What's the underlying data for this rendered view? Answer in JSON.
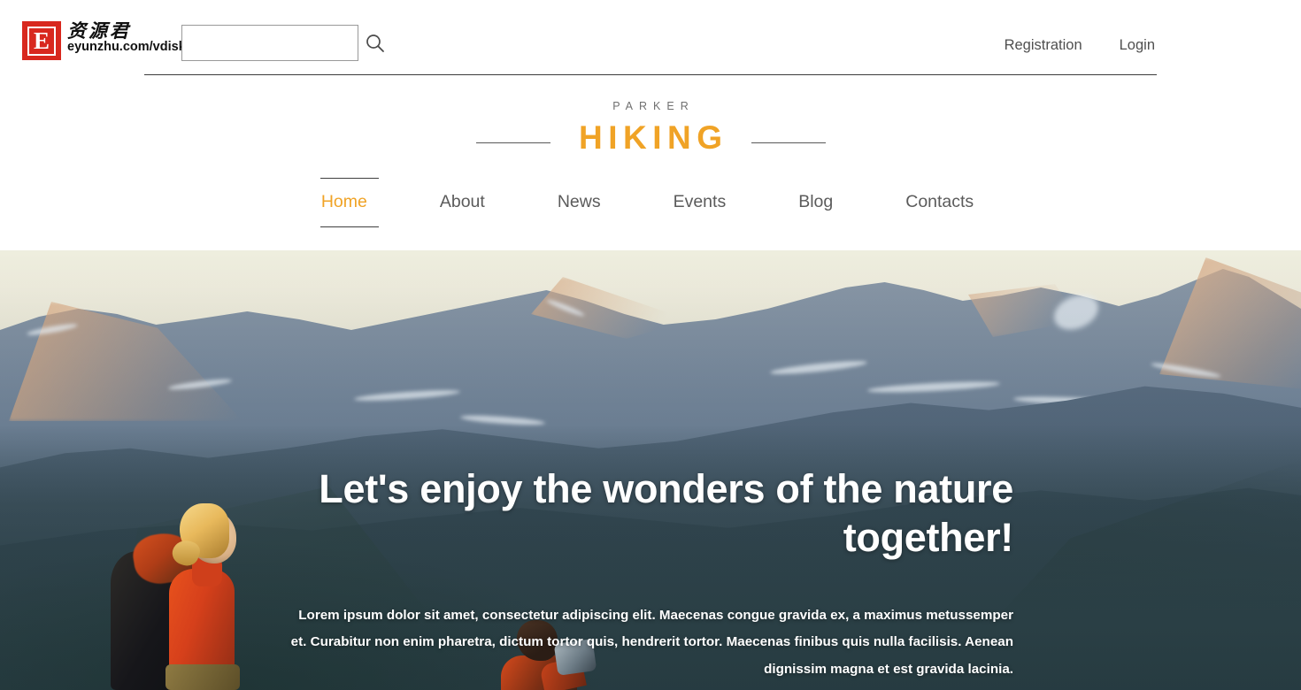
{
  "browser_bar": {
    "brand": {
      "badge_letter": "E",
      "name_cn": "资源君",
      "url": "eyunzhu.com/vdisk"
    },
    "search": {
      "value": "",
      "placeholder": "",
      "icon": "search-icon"
    },
    "links": [
      {
        "label": "Registration"
      },
      {
        "label": "Login"
      }
    ]
  },
  "site": {
    "logo": {
      "kicker": "PARKER",
      "name": "HIKING",
      "accent_color": "#f0a326",
      "rule_color": "#585858"
    },
    "nav": {
      "items": [
        {
          "label": "Home",
          "active": true
        },
        {
          "label": "About",
          "active": false
        },
        {
          "label": "News",
          "active": false
        },
        {
          "label": "Events",
          "active": false
        },
        {
          "label": "Blog",
          "active": false
        },
        {
          "label": "Contacts",
          "active": false
        }
      ]
    }
  },
  "hero": {
    "title": "Let's enjoy the wonders of the nature together!",
    "subtitle": "Lorem ipsum dolor sit amet, consectetur adipiscing elit. Maecenas congue gravida ex, a maximus metussemper et. Curabitur non enim pharetra, dictum tortor quis, hendrerit tortor. Maecenas finibus quis nulla facilisis. Aenean dignissim magna et est gravida lacinia.",
    "image_description": "mountain-range-at-sunrise-with-hikers",
    "colors": {
      "sky": "#eeeede",
      "far_ridge": "#7d8fa2",
      "mid_ridge": "#4c6073",
      "near_ridge": "#35485a",
      "forest": "#2c4147",
      "text": "#ffffff"
    }
  }
}
